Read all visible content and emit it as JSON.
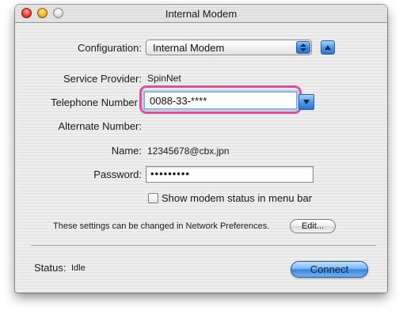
{
  "window": {
    "title": "Internal Modem"
  },
  "form": {
    "configuration_label": "Configuration:",
    "configuration_value": "Internal Modem",
    "service_provider_label": "Service Provider:",
    "service_provider_value": "SpinNet",
    "telephone_label": "Telephone Number",
    "telephone_value": "0088-33-****",
    "alternate_label": "Alternate Number:",
    "alternate_value": "",
    "name_label": "Name:",
    "name_value": "12345678@cbx.jpn",
    "password_label": "Password:",
    "password_value": "•••••••••",
    "show_status_label": "Show modem status in menu bar",
    "show_status_checked": false,
    "note": "These settings can be changed in Network Preferences.",
    "edit_label": "Edit..."
  },
  "footer": {
    "status_label": "Status:",
    "status_value": "Idle",
    "connect_label": "Connect"
  },
  "icons": {
    "close": "close-icon",
    "minimize": "minimize-icon",
    "zoom": "zoom-icon",
    "popup_arrows": "up-down-arrows-icon",
    "disclosure": "disclosure-triangle-icon",
    "combo_dropdown": "chevron-down-icon"
  },
  "colors": {
    "highlight_ring": "#e0509a",
    "aqua_blue": "#3b86de",
    "close_red": "#ee3e2f",
    "minimize_yellow": "#f5b12a"
  }
}
